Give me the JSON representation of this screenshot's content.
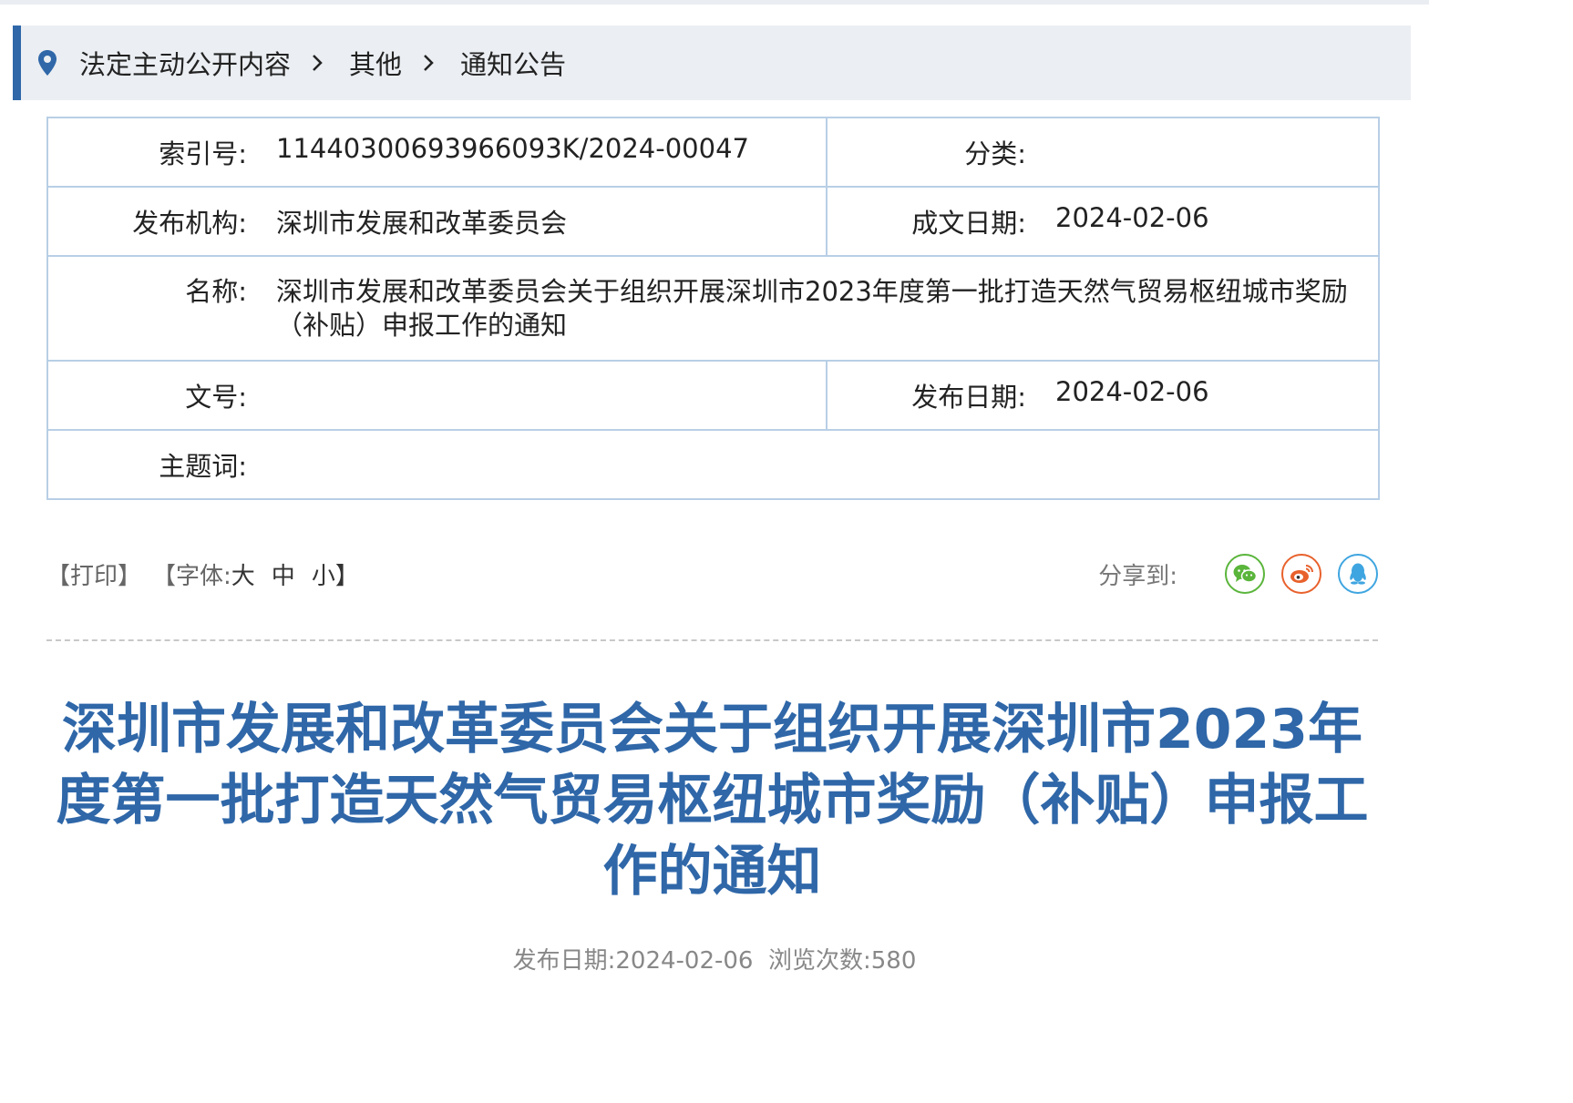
{
  "breadcrumb": {
    "icon": "location-pin-icon",
    "items": [
      "法定主动公开内容",
      "其他",
      "通知公告"
    ]
  },
  "meta": {
    "index_label": "索引号:",
    "index_value": "11440300693966093K/2024-00047",
    "category_label": "分类:",
    "category_value": "",
    "publisher_label": "发布机构:",
    "publisher_value": "深圳市发展和改革委员会",
    "written_date_label": "成文日期:",
    "written_date_value": "2024-02-06",
    "name_label": "名称:",
    "name_value": "深圳市发展和改革委员会关于组织开展深圳市2023年度第一批打造天然气贸易枢纽城市奖励（补贴）申报工作的通知",
    "doc_no_label": "文号:",
    "doc_no_value": "",
    "publish_date_label": "发布日期:",
    "publish_date_value": "2024-02-06",
    "keywords_label": "主题词:",
    "keywords_value": ""
  },
  "toolbar": {
    "print_label": "【打印】",
    "font_label": "【字体:",
    "font_large": "大",
    "font_medium": "中",
    "font_small": "小】",
    "share_label": "分享到:",
    "share_icons": [
      "wechat-icon",
      "weibo-icon",
      "qq-icon"
    ],
    "share_colors": {
      "wechat": "#5ab53b",
      "weibo": "#e8612c",
      "qq": "#3fa5e0"
    }
  },
  "article": {
    "title": "深圳市发展和改革委员会关于组织开展深圳市2023年度第一批打造天然气贸易枢纽城市奖励（补贴）申报工作的通知",
    "date_label": "发布日期:",
    "date_value": "2024-02-06",
    "views_label": "浏览次数:",
    "views_value": "580"
  },
  "colors": {
    "accent": "#2f67a8",
    "table_border": "#b8cfe6",
    "breadcrumb_bg": "#ebeef2"
  }
}
